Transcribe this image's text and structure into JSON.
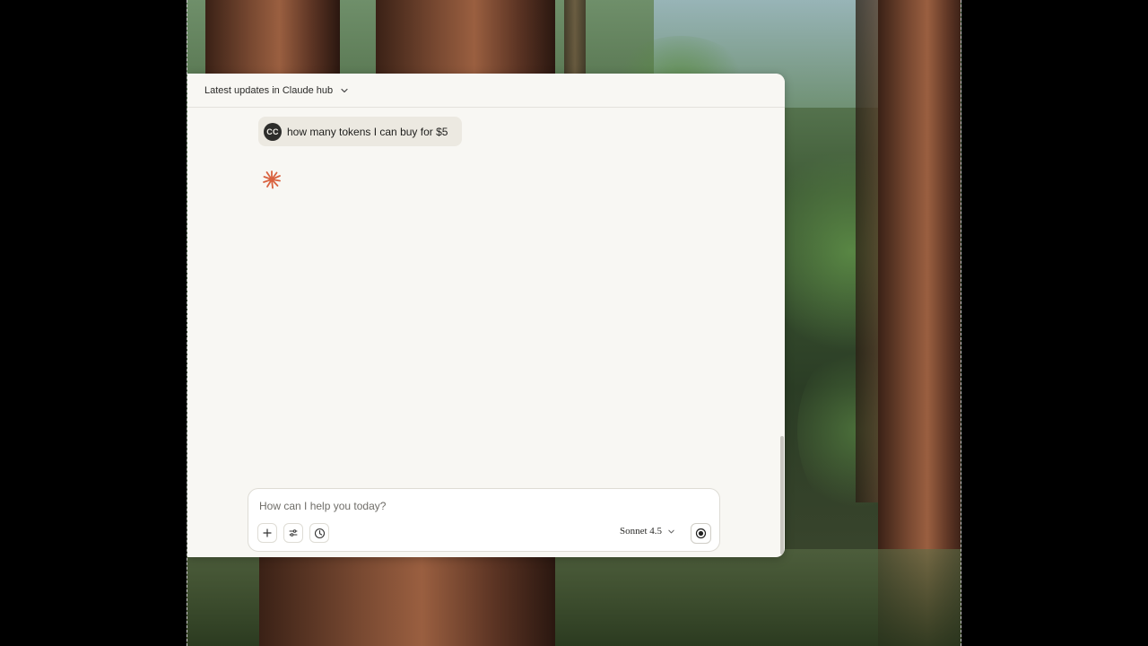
{
  "header": {
    "chat_title": "Latest updates in Claude hub"
  },
  "conversation": {
    "user_initials": "CC",
    "user_message": "how many tokens I can buy for $5"
  },
  "composer": {
    "placeholder": "How can I help you today?",
    "model_label": "Sonnet 4.5"
  },
  "icons": {
    "title_menu": "chevron-down-icon",
    "thinking": "claude-spark-icon",
    "add": "plus-icon",
    "tools": "sliders-icon",
    "history": "clock-icon",
    "model_menu": "chevron-down-icon",
    "voice": "voice-mode-icon"
  },
  "colors": {
    "accent": "#d9623f",
    "window_bg": "#f8f7f3",
    "bubble_bg": "#ece9e1"
  }
}
